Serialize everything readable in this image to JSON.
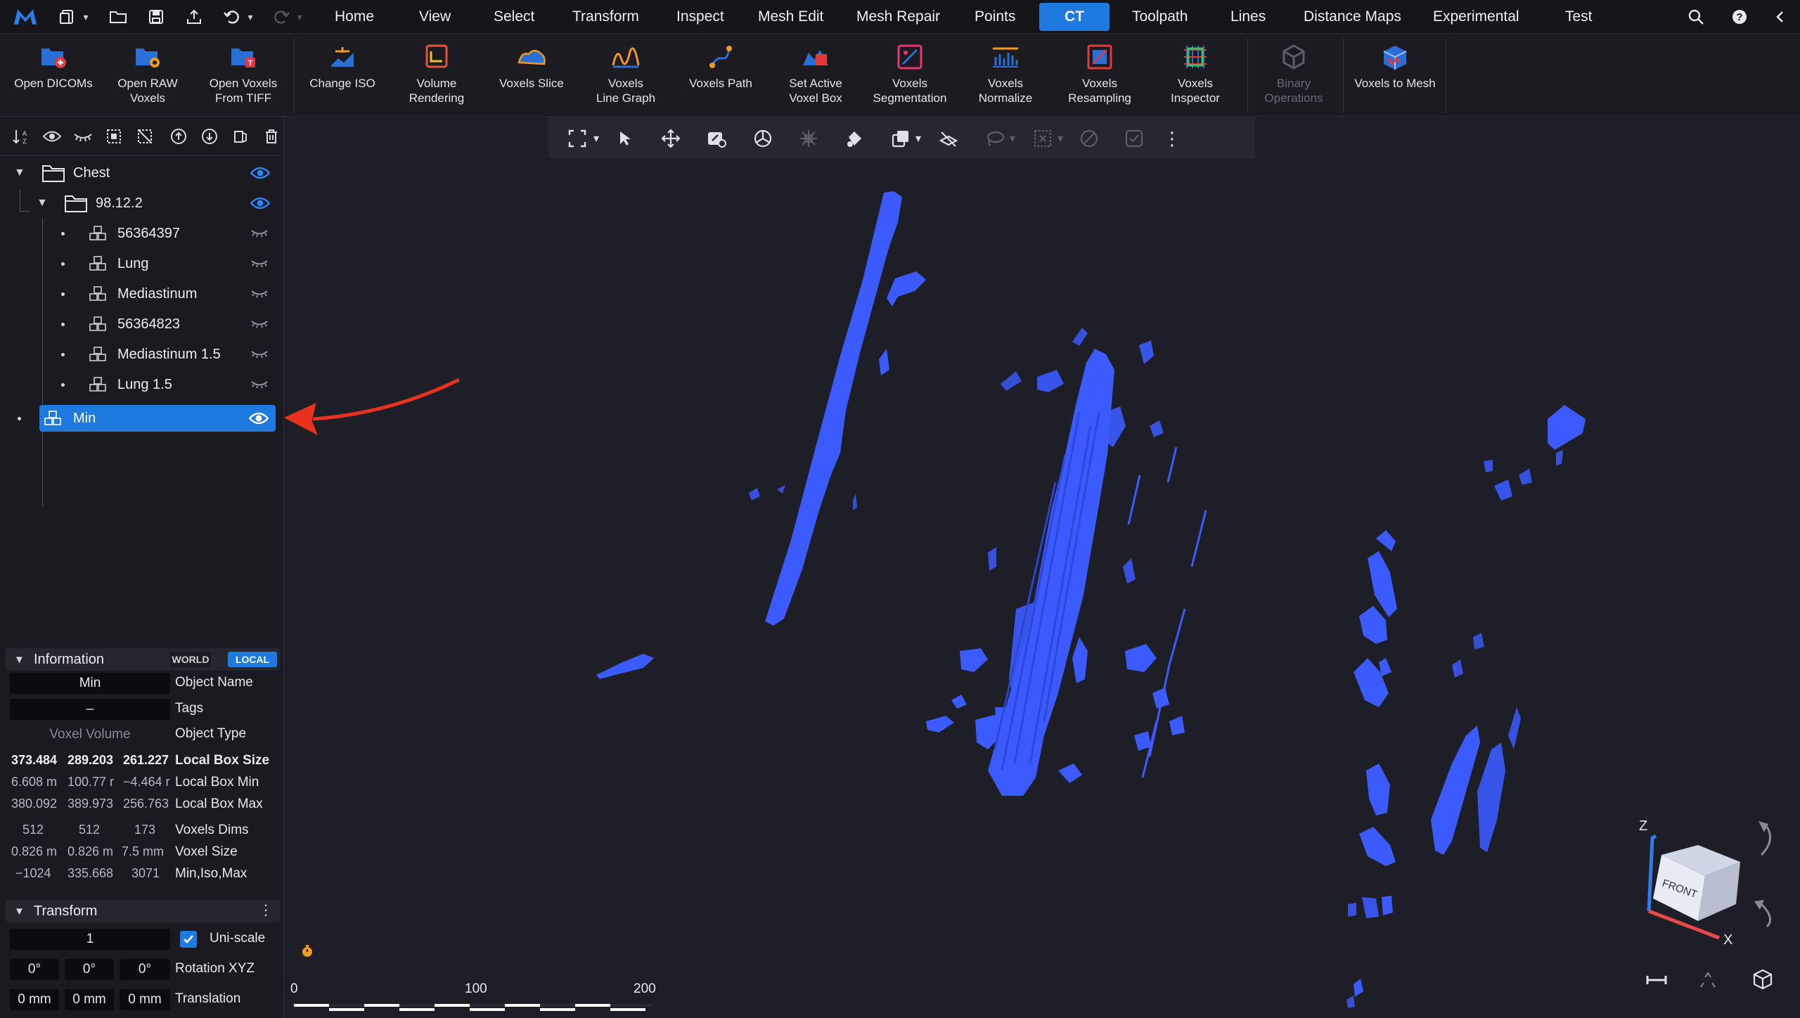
{
  "menubar": {
    "tabs": [
      {
        "label": "Home"
      },
      {
        "label": "View"
      },
      {
        "label": "Select"
      },
      {
        "label": "Transform"
      },
      {
        "label": "Inspect"
      },
      {
        "label": "Mesh Edit"
      },
      {
        "label": "Mesh Repair"
      },
      {
        "label": "Points"
      },
      {
        "label": "CT"
      },
      {
        "label": "Toolpath"
      },
      {
        "label": "Lines"
      },
      {
        "label": "Distance Maps"
      },
      {
        "label": "Experimental"
      },
      {
        "label": "Test"
      }
    ],
    "active_tab": "CT"
  },
  "ribbon": {
    "buttons": [
      {
        "label": "Open DICOMs",
        "icon": "folder-plus-icon"
      },
      {
        "label": "Open RAW\nVoxels",
        "icon": "folder-gear-icon"
      },
      {
        "label": "Open Voxels\nFrom TIFF",
        "icon": "folder-tiff-icon"
      },
      {
        "label": "Change ISO",
        "icon": "iso-icon"
      },
      {
        "label": "Volume\nRendering",
        "icon": "volume-rendering-icon"
      },
      {
        "label": "Voxels Slice",
        "icon": "voxels-slice-icon"
      },
      {
        "label": "Voxels\nLine Graph",
        "icon": "line-graph-icon"
      },
      {
        "label": "Voxels Path",
        "icon": "voxels-path-icon"
      },
      {
        "label": "Set Active\nVoxel Box",
        "icon": "voxel-box-icon"
      },
      {
        "label": "Voxels\nSegmentation",
        "icon": "segmentation-icon"
      },
      {
        "label": "Voxels\nNormalize",
        "icon": "normalize-icon"
      },
      {
        "label": "Voxels\nResampling",
        "icon": "resampling-icon"
      },
      {
        "label": "Voxels\nInspector",
        "icon": "inspector-icon"
      },
      {
        "label": "Binary\nOperations",
        "icon": "binary-operations-icon",
        "disabled": true
      },
      {
        "label": "Voxels to Mesh",
        "icon": "voxels-to-mesh-icon"
      }
    ]
  },
  "tree": {
    "items": [
      {
        "label": "Chest"
      },
      {
        "label": "98.12.2"
      },
      {
        "label": "56364397"
      },
      {
        "label": "Lung"
      },
      {
        "label": "Mediastinum"
      },
      {
        "label": "56364823"
      },
      {
        "label": "Mediastinum 1.5"
      },
      {
        "label": "Lung 1.5"
      },
      {
        "label": "Min"
      }
    ],
    "selected": "Min"
  },
  "information": {
    "title": "Information",
    "world_label": "WORLD",
    "local_label": "LOCAL",
    "object_name_value": "Min",
    "object_name_label": "Object Name",
    "tags_value": "–",
    "tags_label": "Tags",
    "object_type_value": "Voxel Volume",
    "object_type_label": "Object Type",
    "rows": [
      {
        "label": "Local Box Size",
        "values": [
          "373.484",
          "289.203",
          "261.227"
        ],
        "bold": true
      },
      {
        "label": "Local Box Min",
        "values": [
          "6.608 m",
          "100.77 r",
          "−4.464 r"
        ]
      },
      {
        "label": "Local Box Max",
        "values": [
          "380.092",
          "389.973",
          "256.763"
        ]
      },
      {
        "label": "Voxels Dims",
        "values": [
          "512",
          "512",
          "173"
        ]
      },
      {
        "label": "Voxel Size",
        "values": [
          "0.826 m",
          "0.826 m",
          "7.5 mm"
        ]
      },
      {
        "label": "Min,Iso,Max",
        "values": [
          "−1024",
          "335.668",
          "3071"
        ]
      }
    ]
  },
  "transform": {
    "title": "Transform",
    "scale_value": "1",
    "uniscale_label": "Uni-scale",
    "uniscale_checked": true,
    "rotation": [
      "0°",
      "0°",
      "0°"
    ],
    "rotation_label": "Rotation XYZ",
    "translation": [
      "0 mm",
      "0 mm",
      "0 mm"
    ],
    "translation_label": "Translation"
  },
  "viewport": {
    "scale_ticks": [
      "0",
      "100",
      "200"
    ],
    "axis_labels": {
      "z": "Z",
      "x": "X"
    },
    "cube_face": "FRONT",
    "render_color": "#3b5bff"
  },
  "colors": {
    "accent": "#1f7ae0",
    "annotation_arrow": "#e8321f"
  }
}
